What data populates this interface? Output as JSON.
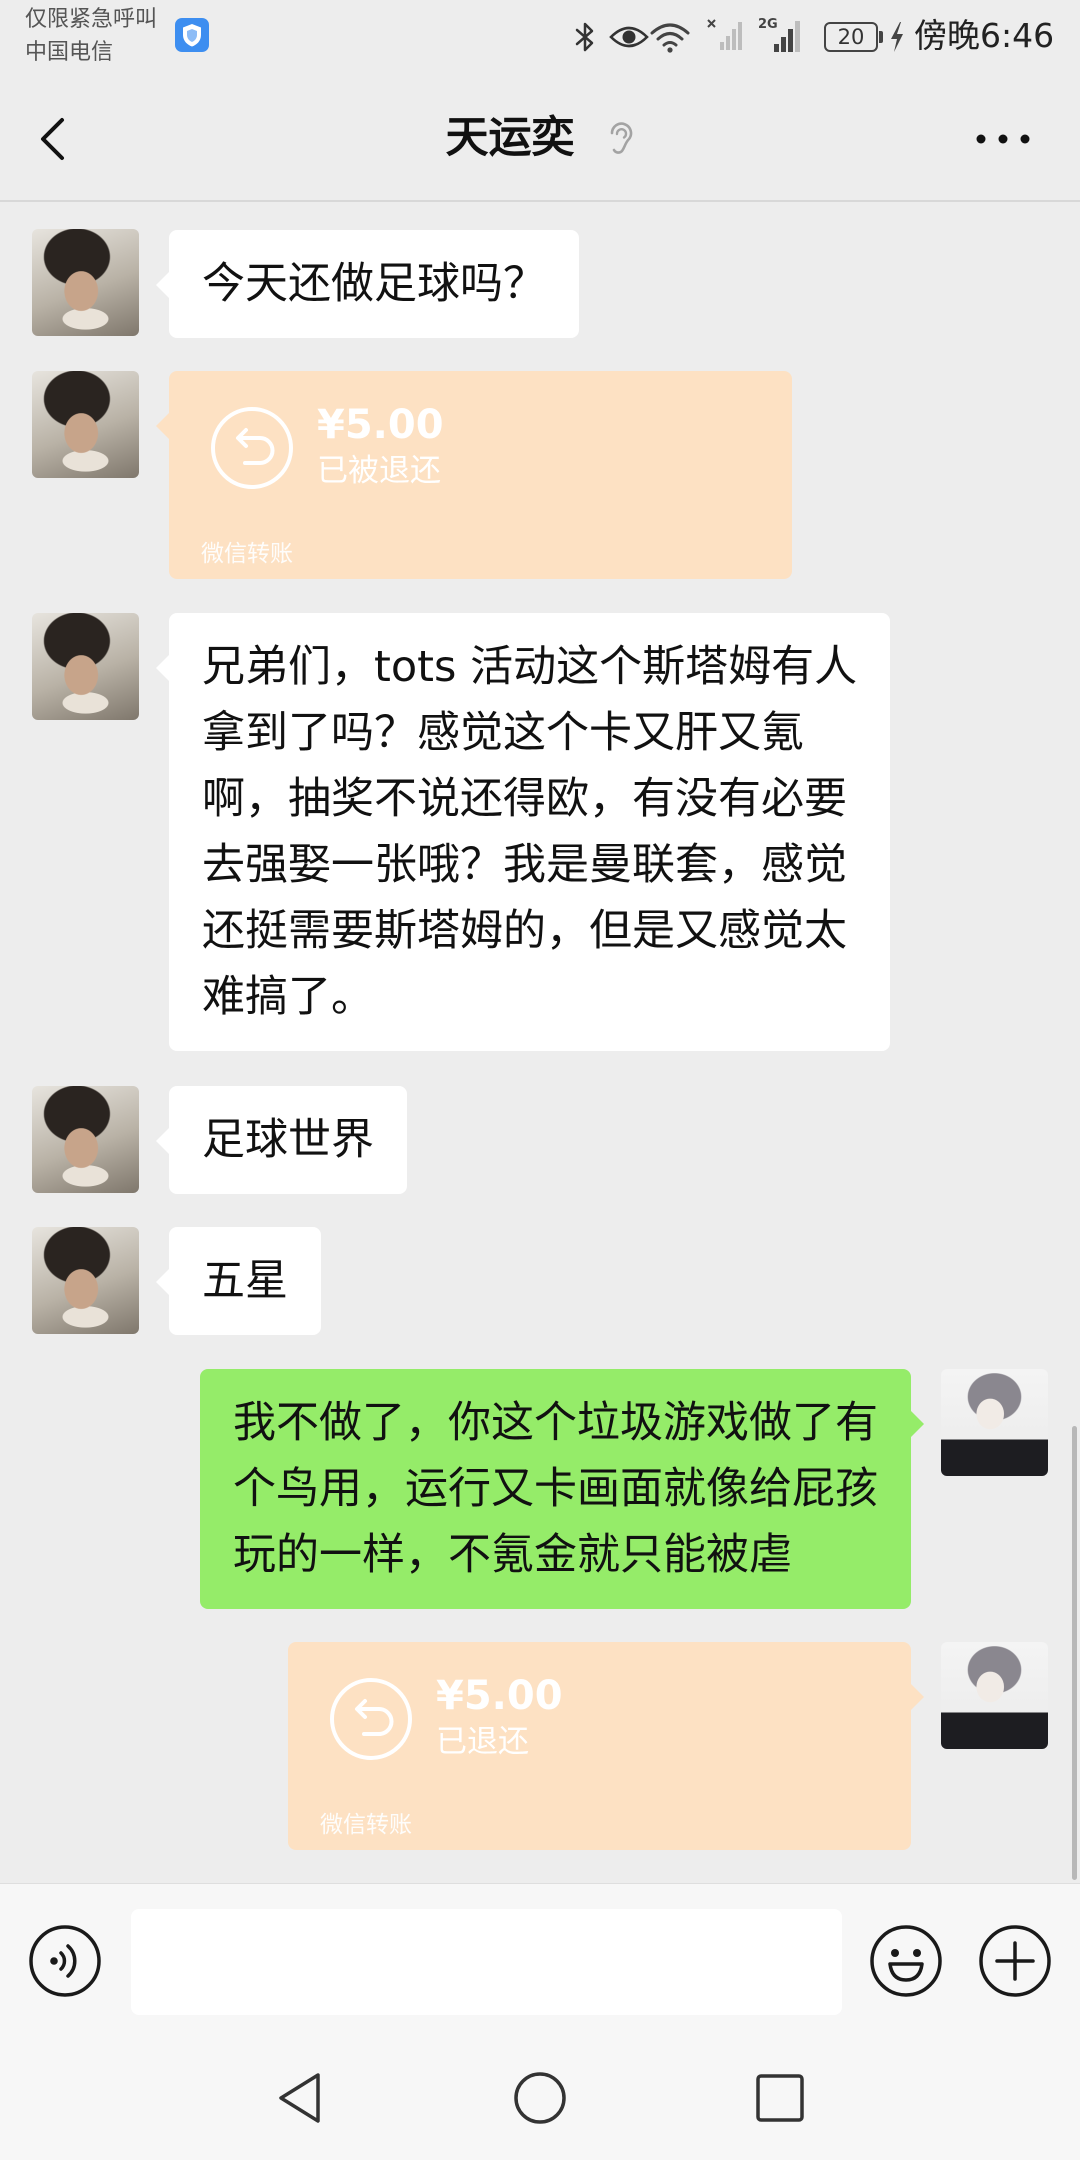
{
  "status_bar": {
    "emergency_text": "仅限紧急呼叫",
    "carrier": "中国电信",
    "network_label": "2G",
    "battery_level": "20",
    "time": "傍晚6:46",
    "icons": [
      "shield-icon",
      "bluetooth-icon",
      "eye-icon",
      "wifi-icon",
      "signal-no-sim-icon",
      "signal-icon",
      "battery-icon",
      "charging-icon"
    ]
  },
  "header": {
    "title": "天运奕",
    "icons": {
      "back": "chevron-left-icon",
      "earpiece_mode": "ear-icon",
      "more": "more-dots-icon"
    }
  },
  "messages": [
    {
      "sender": "contact",
      "type": "text",
      "text": "今天还做足球吗？"
    },
    {
      "sender": "contact",
      "type": "transfer",
      "amount": "¥5.00",
      "status": "已被退还",
      "label": "微信转账"
    },
    {
      "sender": "contact",
      "type": "text",
      "text": "兄弟们，tots 活动这个斯塔姆有人\n拿到了吗？感觉这个卡又肝又氪\n啊，抽奖不说还得欧，有没有必要\n去强娶一张哦？我是曼联套，感觉\n还挺需要斯塔姆的，但是又感觉太\n难搞了。"
    },
    {
      "sender": "contact",
      "type": "text",
      "text": "足球世界"
    },
    {
      "sender": "contact",
      "type": "text",
      "text": "五星"
    },
    {
      "sender": "me",
      "type": "text",
      "text": "我不做了，你这个垃圾游戏做了有\n个鸟用，运行又卡画面就像给屁孩\n玩的一样，不氪金就只能被虐"
    },
    {
      "sender": "me",
      "type": "transfer",
      "amount": "¥5.00",
      "status": "已退还",
      "label": "微信转账"
    }
  ],
  "input_bar": {
    "value": "",
    "icons": {
      "voice": "voice-input-icon",
      "emoji": "emoji-icon",
      "more": "plus-icon"
    }
  },
  "nav_bar": {
    "icons": [
      "nav-back-icon",
      "nav-home-icon",
      "nav-recents-icon"
    ]
  },
  "colors": {
    "chat_background": "#ededed",
    "incoming_bubble": "#ffffff",
    "outgoing_bubble": "#95ec69",
    "transfer_returned": "#fde1c3",
    "bottom_bar": "#f7f7f7"
  }
}
